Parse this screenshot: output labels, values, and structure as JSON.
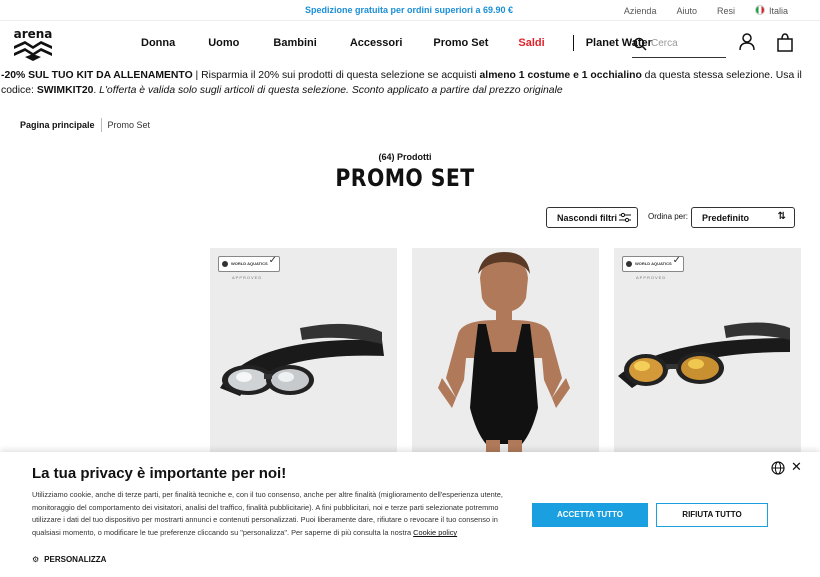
{
  "topbar": {
    "promo": "Spedizione gratuita per ordini superiori a 69.90 €",
    "links": [
      "Azienda",
      "Aiuto",
      "Resi"
    ],
    "country": "Italia"
  },
  "header": {
    "logo_text": "arena",
    "nav": [
      {
        "label": "Donna"
      },
      {
        "label": "Uomo"
      },
      {
        "label": "Bambini"
      },
      {
        "label": "Accessori"
      },
      {
        "label": "Promo Set"
      },
      {
        "label": "Saldi",
        "color": "#e0222a"
      },
      {
        "label": "Planet Water"
      }
    ],
    "search_placeholder": "Cerca"
  },
  "offer": {
    "headline": "-20% SUL TUO KIT DA ALLENAMENTO",
    "text1": " | Risparmia il 20% sui prodotti di questa selezione se acquisti ",
    "bold1": "almeno 1 costume e 1 occhialino",
    "text2": " da questa stessa selezione. Usa il codice: ",
    "code": "SWIMKIT20",
    "text3": ". ",
    "note": "L'offerta è valida solo sugli articoli di questa selezione. Sconto applicato a partire dal prezzo originale"
  },
  "breadcrumb": {
    "home": "Pagina principale",
    "current": "Promo Set"
  },
  "listing": {
    "count": "(64) Prodotti",
    "title": "PROMO SET",
    "filter_button": "Nascondi filtri",
    "sort_label": "Ordina per:",
    "sort_value": "Predefinito"
  },
  "products": [
    {
      "badge": "WORLD AQUATICS",
      "badge_sub": "APPROVED",
      "kind": "goggles-silver"
    },
    {
      "kind": "swimsuit-black"
    },
    {
      "badge": "WORLD AQUATICS",
      "badge_sub": "APPROVED",
      "kind": "goggles-gold"
    }
  ],
  "cookie": {
    "title": "La tua privacy è importante per noi!",
    "body": "Utilizziamo cookie, anche di terze parti, per finalità tecniche e, con il tuo consenso, anche per altre finalità (miglioramento dell'esperienza utente, monitoraggio del comportamento dei visitatori, analisi del traffico, finalità pubblicitarie). A fini pubblicitari, noi e terze parti selezionate potremmo utilizzare i dati del tuo dispositivo per mostrarti annunci e contenuti personalizzati. Puoi liberamente dare, rifiutare o revocare il tuo consenso in qualsiasi momento, o modificare le tue preferenze cliccando su \"personalizza\". Per saperne di più consulta la nostra ",
    "policy_link": "Cookie policy",
    "personalize": "PERSONALIZZA",
    "accept": "ACCETTA TUTTO",
    "reject": "RIFIUTA TUTTO",
    "accent": "#1aa0e0"
  }
}
